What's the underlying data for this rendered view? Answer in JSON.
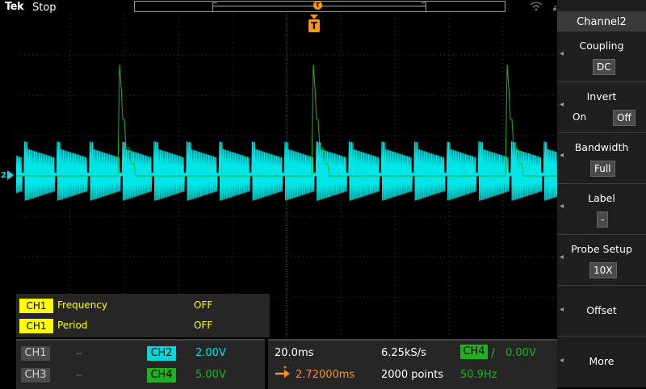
{
  "header": {
    "brand": "Tek",
    "run_state": "Stop",
    "trigger_marker": "T",
    "icons": [
      "wifi-icon",
      "network-icon",
      "usb-icon",
      "help-icon"
    ],
    "help_glyph": "?"
  },
  "display": {
    "trigger_label": "T",
    "ch2_ref": "2",
    "colors": {
      "ch2": "#00e5e5",
      "ch4": "#22b022",
      "trigger": "#f7941d",
      "measurement": "#ffff00"
    }
  },
  "measurements": [
    {
      "source": "CH1",
      "name": "Frequency",
      "value": "OFF"
    },
    {
      "source": "CH1",
      "name": "Period",
      "value": "OFF"
    }
  ],
  "channels": {
    "ch1": {
      "label": "CH1",
      "value": "--"
    },
    "ch2": {
      "label": "CH2",
      "value": "2.00V"
    },
    "ch3": {
      "label": "CH3",
      "value": "--"
    },
    "ch4": {
      "label": "CH4",
      "value": "5.00V"
    }
  },
  "timebase": {
    "scale": "20.0ms",
    "sample_rate": "6.25kS/s",
    "position": "2.72000ms",
    "record_length": "2000 points"
  },
  "trigger": {
    "source": "CH4",
    "slope_glyph": "∕",
    "level": "0.00V",
    "frequency": "50.9Hz"
  },
  "side_menu": {
    "title": "Channel2",
    "coupling": {
      "label": "Coupling",
      "value": "DC"
    },
    "invert": {
      "label": "Invert",
      "on": "On",
      "off": "Off"
    },
    "bandwidth": {
      "label": "Bandwidth",
      "value": "Full"
    },
    "label": {
      "label": "Label",
      "value": "-"
    },
    "probe_setup": {
      "label": "Probe Setup",
      "value": "10X"
    },
    "offset": {
      "label": "Offset"
    },
    "more": {
      "label": "More"
    }
  }
}
